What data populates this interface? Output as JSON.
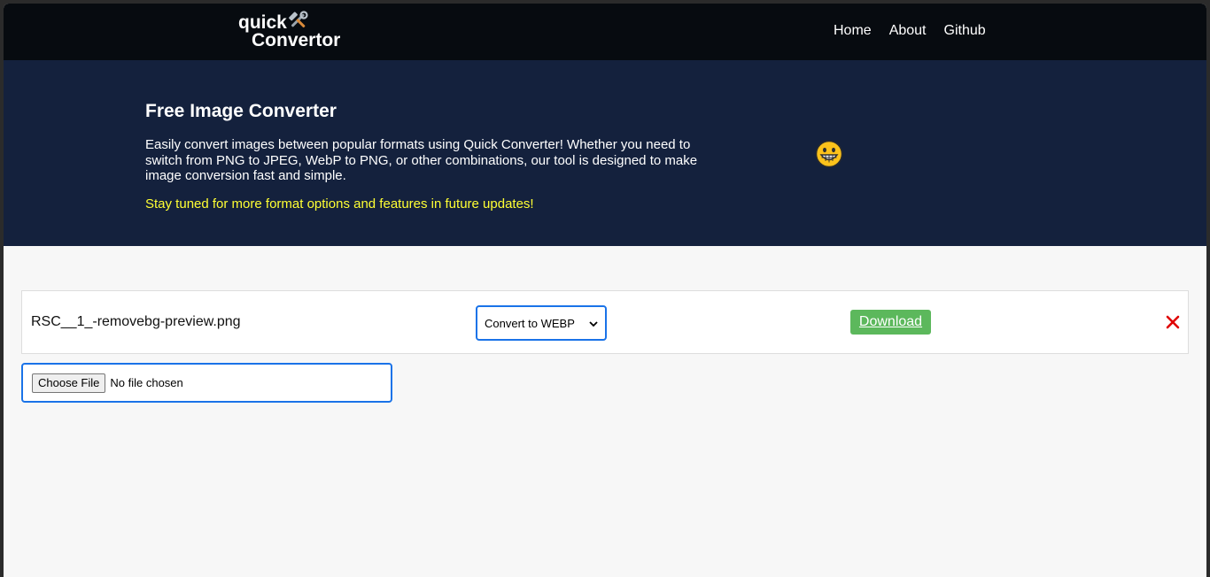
{
  "brand": {
    "line1": "quick",
    "line2": "Convertor",
    "icon": "hammer-and-wrench-icon"
  },
  "nav": {
    "items": [
      {
        "label": "Home"
      },
      {
        "label": "About"
      },
      {
        "label": "Github"
      }
    ]
  },
  "hero": {
    "title": "Free Image Converter",
    "description": "Easily convert images between popular formats using Quick Converter! Whether you need to switch from PNG to JPEG, WebP to PNG, or other combinations, our tool is designed to make image conversion fast and simple.",
    "note": "Stay tuned for more format options and features in future updates!",
    "emoji": "grinning-face-icon"
  },
  "file_list": [
    {
      "name": "RSC__1_-removebg-preview.png",
      "convert_selected": "Convert to WEBP",
      "download_label": "Download"
    }
  ],
  "file_input": {
    "button_label": "Choose File",
    "status": "No file chosen"
  },
  "colors": {
    "navbar_bg": "#070b10",
    "hero_bg": "#14213d",
    "note_text": "#ffff33",
    "download_bg": "#5cb85c",
    "remove_x": "#e00000",
    "focus_border": "#1a73e8"
  }
}
